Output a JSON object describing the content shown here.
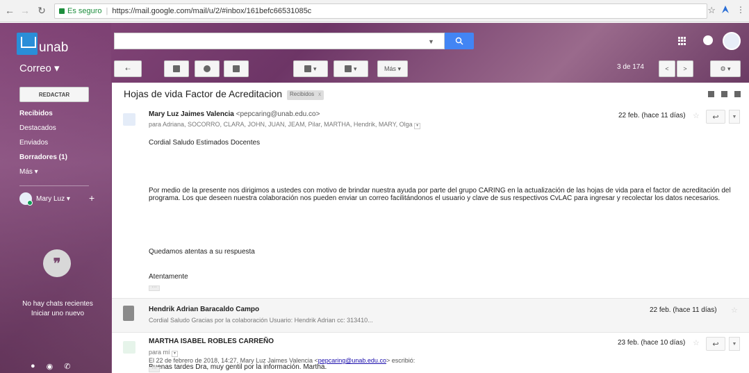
{
  "browser": {
    "secure_label": "Es seguro",
    "url": "https://mail.google.com/mail/u/2/#inbox/161befc66531085c"
  },
  "brand": {
    "logo_text": "unab"
  },
  "app": {
    "section_label": "Correo ▾"
  },
  "toolbar": {
    "more_label": "Más ▾",
    "pager": "3 de 174"
  },
  "sidebar": {
    "compose_label": "REDACTAR",
    "items": [
      {
        "label": "Recibidos"
      },
      {
        "label": "Destacados"
      },
      {
        "label": "Enviados"
      },
      {
        "label": "Borradores (1)"
      },
      {
        "label": "Más ▾"
      }
    ],
    "user_name": "Mary Luz ▾",
    "hangouts": {
      "no_chats": "No hay chats recientes",
      "start_new": "Iniciar uno nuevo"
    }
  },
  "thread": {
    "subject": "Hojas de vida Factor de Acreditacion",
    "label": "Recibidos",
    "label_close": "x",
    "messages": [
      {
        "sender": "Mary Luz Jaimes Valencia",
        "email": "<pepcaring@unab.edu.co>",
        "recipients": "para Adriana, SOCORRO, CLARA, JOHN, JUAN, JEAM, Pilar, MARTHA, Hendrik, MARY, Olga",
        "date": "22 feb. (hace 11 días)",
        "greeting": "Cordial Saludo Estimados Docentes",
        "body": "Por medio de la presente nos dirigimos a ustedes con motivo de brindar nuestra ayuda por parte del grupo CARING en la actualización de las hojas de vida para el factor de acreditación del programa. Los que deseen nuestra colaboración nos pueden enviar un correo facilitándonos el usuario y clave de sus respectivos CvLAC para ingresar y recolectar los datos necesarios.",
        "closing1": "Quedamos atentas a su respuesta",
        "closing2": "Atentamente",
        "ellipsis": "···"
      },
      {
        "sender": "Hendrik Adrian Baracaldo Campo",
        "snippet": "Cordial Saludo Gracias por la colaboración Usuario: Hendrik Adrian cc: 313410...",
        "date": "22 feb. (hace 11 días)"
      },
      {
        "sender": "MARTHA ISABEL ROBLES CARREÑO",
        "recipients": "para mí",
        "date": "23 feb. (hace 10 días)",
        "body": "Buenas tardes Dra, muy gentil por la información. Martha.",
        "quote_prefix": "El 22 de febrero de 2018, 14:27, Mary Luz Jaimes Valencia <",
        "quote_email": "pepcaring@unab.edu.co",
        "quote_suffix": "> escribió:",
        "ellipsis": "···"
      }
    ]
  }
}
